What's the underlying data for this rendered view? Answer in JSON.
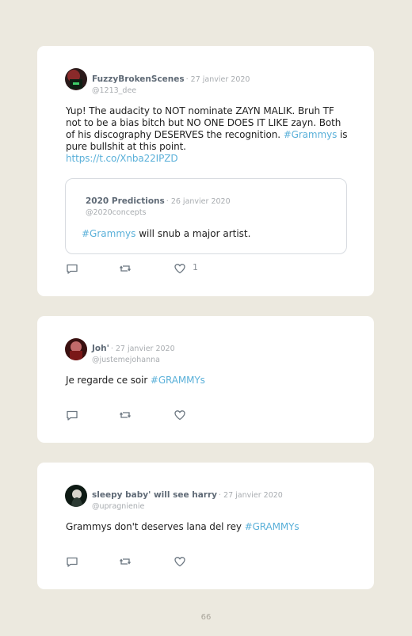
{
  "tweets": [
    {
      "name": "FuzzyBrokenScenes",
      "date": "· 27 janvier 2020",
      "handle": "@1213_dee",
      "text_part1": "Yup! The audacity to NOT nominate ZAYN MALIK. Bruh TF not to be a bias bitch but NO ONE DOES IT LIKE zayn. Both of his discography DESERVES the recognition.",
      "hashtag": "#Grammys",
      "text_part2": " is pure bullshit at this point.",
      "url": "https://t.co/Xnba22IPZD",
      "like_count": "1",
      "quote": {
        "name": "2020 Predictions",
        "date": "· 26 janvier 2020",
        "handle": "@2020concepts",
        "hashtag": "#Grammys",
        "text": " will snub a major artist."
      }
    },
    {
      "name": "Joh'",
      "date": "· 27 janvier 2020",
      "handle": "@justemejohanna",
      "text": "Je regarde ce soir ",
      "hashtag": "#GRAMMYs"
    },
    {
      "name": "sleepy baby' will see harry",
      "date": "· 27 janvier 2020",
      "handle": "@upragnienie",
      "text": "Grammys don't deserves lana del rey ",
      "hashtag": "#GRAMMYs"
    }
  ],
  "icons": {
    "reply": "reply-icon",
    "retweet": "retweet-icon",
    "like": "heart-icon"
  },
  "colors": {
    "link": "#5ab0d9",
    "background": "#ece9df"
  },
  "page_number": "66"
}
